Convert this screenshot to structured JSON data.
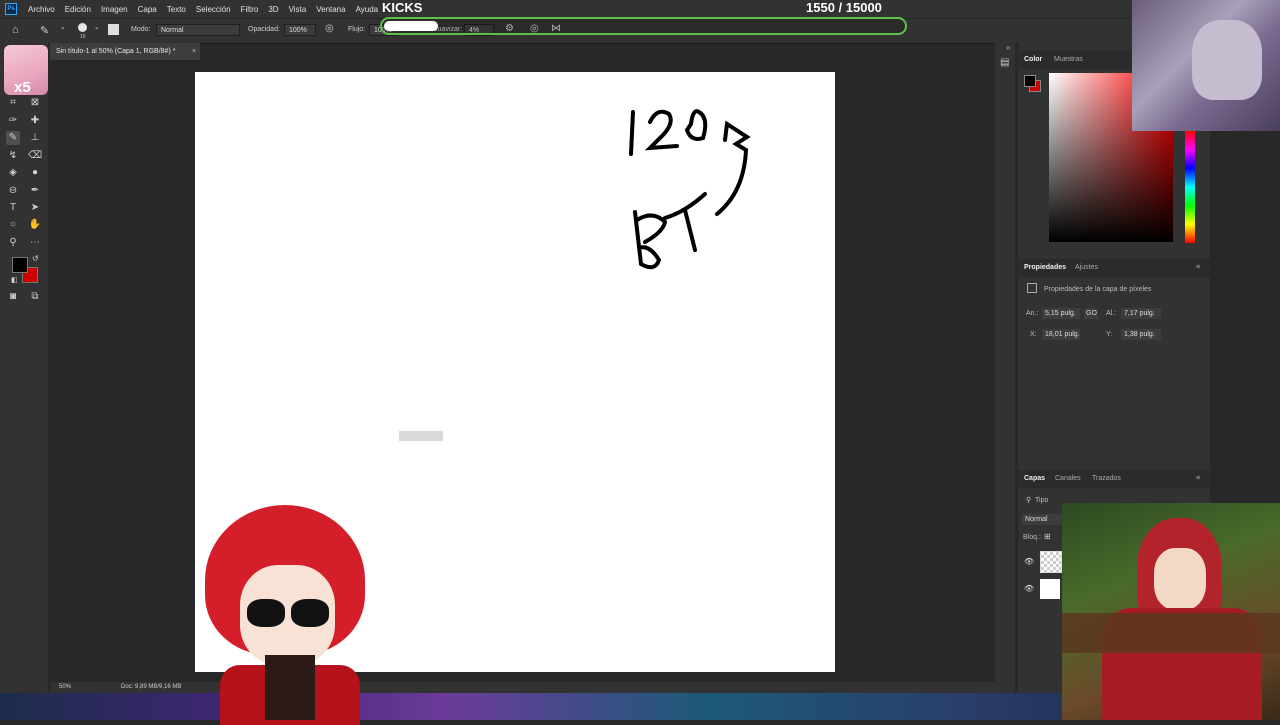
{
  "menubar": {
    "items": [
      "Archivo",
      "Edición",
      "Imagen",
      "Capa",
      "Texto",
      "Selección",
      "Filtro",
      "3D",
      "Vista",
      "Ventana",
      "Ayuda"
    ]
  },
  "options": {
    "mode_label": "Modo:",
    "mode_value": "Normal",
    "opacity_label": "Opacidad:",
    "opacity_value": "100%",
    "flow_label": "Flujo:",
    "flow_value": "100%",
    "smooth_label": "Suavizar:",
    "smooth_value": "4%",
    "brush_size": "15"
  },
  "doc_tab": {
    "title": "Sin título-1 al 50% (Capa 1, RGB/8#) *",
    "close": "×"
  },
  "overlay": {
    "goal_label": "KICKS",
    "progress_text": "1550  / 15000",
    "progress_current": 1550,
    "progress_goal": 15000
  },
  "color_panel": {
    "tabs": [
      "Color",
      "Muestras"
    ],
    "fg_color": "#000000",
    "bg_color": "#cc0000"
  },
  "properties_panel": {
    "tabs": [
      "Propiedades",
      "Ajustes"
    ],
    "subtitle": "Propiedades de la capa de píxeles",
    "w_label": "An.:",
    "w_value": "5,15 pulg.",
    "link_label": "GO",
    "h_label": "Al.:",
    "h_value": "7,17 pulg.",
    "x_label": "X:",
    "x_value": "18,01 pulg.",
    "y_label": "Y:",
    "y_value": "1,38 pulg."
  },
  "layers_panel": {
    "tabs": [
      "Capas",
      "Canales",
      "Trazados"
    ],
    "filter_label": "Tipo",
    "blend_mode": "Normal",
    "lock_label": "Bloq.:"
  },
  "statusbar": {
    "zoom": "50%",
    "doc_info": "Doc: 9,89 MB/9,16 MB"
  },
  "canvas_drawing": {
    "text_1": "120",
    "text_2": "BT"
  },
  "badge": {
    "text": "x5"
  }
}
